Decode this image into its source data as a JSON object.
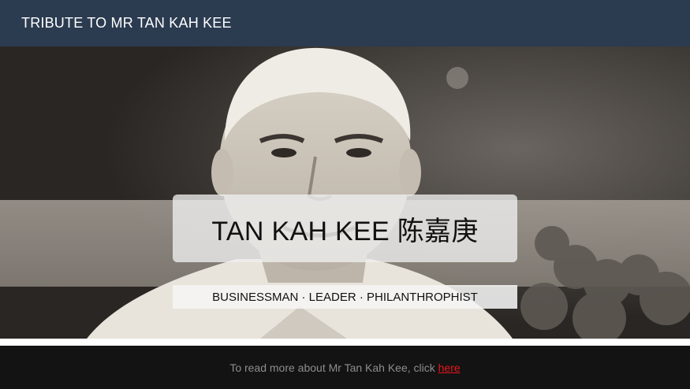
{
  "navbar": {
    "brand": "TRIBUTE TO MR TAN KAH KEE"
  },
  "hero": {
    "image_subject": "black-and-white portrait photograph of Tan Kah Kee",
    "title": "TAN KAH KEE 陈嘉庚",
    "subtitle": "BUSINESSMAN · LEADER · PHILANTHROPHIST"
  },
  "footer": {
    "text": "To read more about Mr Tan Kah Kee, click ",
    "link_label": "here"
  },
  "colors": {
    "navbar_bg": "#2b3b50",
    "footer_bg": "#131313",
    "footer_text": "#8d8d8d",
    "link": "#e8151c"
  }
}
